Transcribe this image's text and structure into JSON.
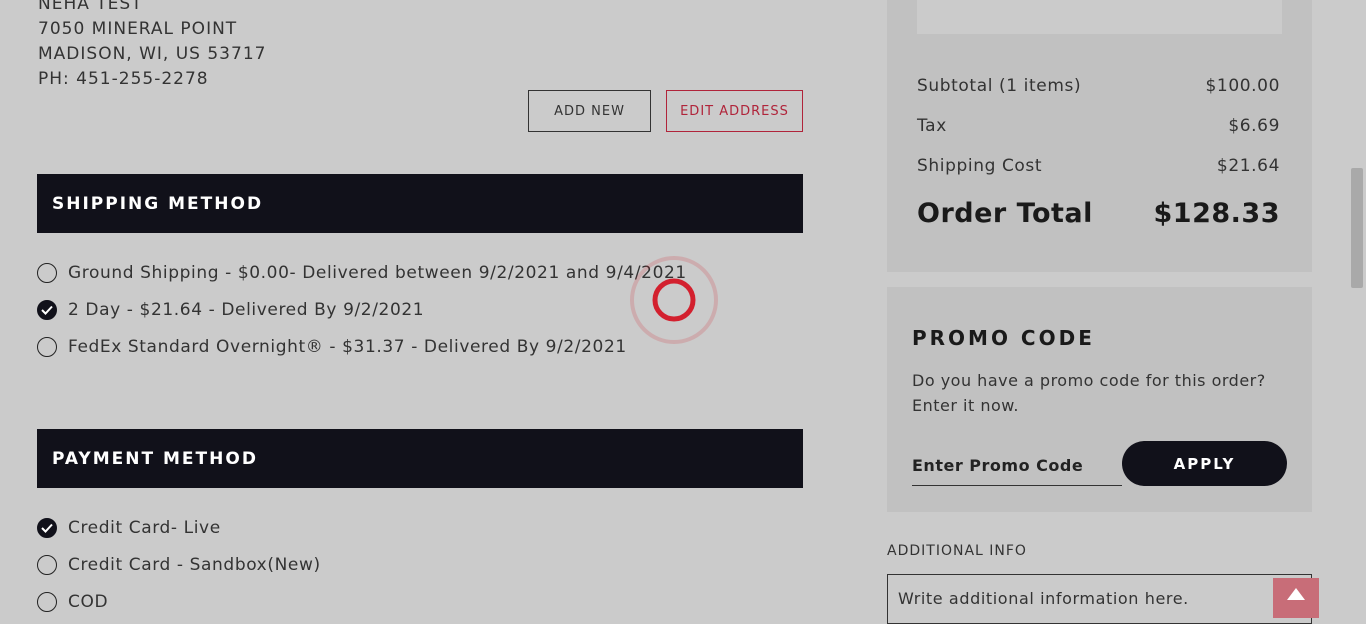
{
  "address": {
    "name": "NEHA TEST",
    "street": "7050 MINERAL POINT",
    "city": "MADISON, WI, US 53717",
    "phone": "PH: 451-255-2278"
  },
  "address_actions": {
    "add_new": "ADD NEW",
    "edit": "EDIT ADDRESS"
  },
  "shipping": {
    "title": "SHIPPING METHOD",
    "options": [
      {
        "label": "Ground Shipping - $0.00- Delivered between 9/2/2021 and 9/4/2021",
        "checked": false
      },
      {
        "label": "2 Day - $21.64 - Delivered By 9/2/2021",
        "checked": true
      },
      {
        "label": "FedEx Standard Overnight® - $31.37 - Delivered By 9/2/2021",
        "checked": false
      }
    ]
  },
  "payment": {
    "title": "PAYMENT METHOD",
    "options": [
      {
        "label": "Credit Card- Live",
        "checked": true
      },
      {
        "label": "Credit Card - Sandbox(New)",
        "checked": false
      },
      {
        "label": "COD",
        "checked": false
      }
    ]
  },
  "summary": {
    "subtotal_label": "Subtotal (1 items)",
    "subtotal_value": "$100.00",
    "tax_label": "Tax",
    "tax_value": "$6.69",
    "shipping_label": "Shipping Cost",
    "shipping_value": "$21.64",
    "total_label": "Order Total",
    "total_value": "$128.33"
  },
  "promo": {
    "title": "PROMO CODE",
    "description": "Do you have a promo code for this order? Enter it now.",
    "placeholder": "Enter Promo Code",
    "apply_label": "APPLY"
  },
  "additional_info": {
    "label": "ADDITIONAL INFO",
    "placeholder": "Write additional information here."
  },
  "icons": {
    "check": "check-icon",
    "scroll_top": "arrow-up-icon",
    "loading": "loading-spinner-icon"
  },
  "colors": {
    "dark": "#11111a",
    "accent_red": "#b0243a",
    "scroll_top_bg": "#c86d78",
    "spinner": "#d3202e"
  }
}
